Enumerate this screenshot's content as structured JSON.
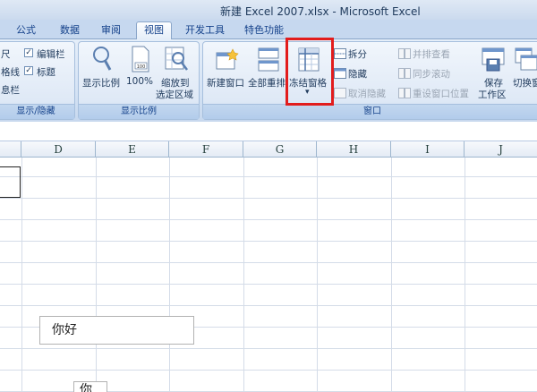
{
  "window": {
    "title": "新建 Excel 2007.xlsx - Microsoft Excel"
  },
  "tabs": [
    {
      "id": "formulas",
      "label": "公式"
    },
    {
      "id": "data",
      "label": "数据"
    },
    {
      "id": "review",
      "label": "审阅"
    },
    {
      "id": "view",
      "label": "视图",
      "active": true
    },
    {
      "id": "developer",
      "label": "开发工具"
    },
    {
      "id": "special",
      "label": "特色功能"
    }
  ],
  "ribbon": {
    "show_hide": {
      "label": "显示/隐藏",
      "ruler_partial": "尺",
      "gridlines_partial": "格线",
      "message_bar_partial": "息栏",
      "formula_bar": "编辑栏",
      "headings": "标题"
    },
    "zoom": {
      "label": "显示比例",
      "zoom": "显示比例",
      "hundred": "100%",
      "zoom_to_selection_line1": "缩放到",
      "zoom_to_selection_line2": "选定区域"
    },
    "window": {
      "label": "窗口",
      "new_window": "新建窗口",
      "arrange_all": "全部重排",
      "freeze_panes": "冻结窗格",
      "freeze_dropdown": "▾",
      "split": "拆分",
      "hide": "隐藏",
      "unhide": "取消隐藏",
      "side_by_side": "并排查看",
      "sync_scroll": "同步滚动",
      "reset_position": "重设窗口位置",
      "save_workspace_line1": "保存",
      "save_workspace_line2": "工作区",
      "switch_windows": "切换窗"
    }
  },
  "sheet": {
    "columns": [
      "D",
      "E",
      "F",
      "G",
      "H",
      "I",
      "J"
    ],
    "textbox_text": "你好",
    "textbox2_text": "你"
  }
}
